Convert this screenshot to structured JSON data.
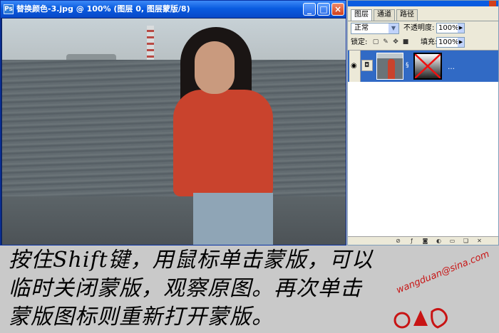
{
  "document_window": {
    "title": "替换颜色-3.jpg @ 100% (图层 0, 图层蒙版/8)",
    "app_icon": "Ps"
  },
  "layers_panel": {
    "tabs": [
      {
        "label": "图层",
        "active": true
      },
      {
        "label": "通道",
        "active": false
      },
      {
        "label": "路径",
        "active": false
      }
    ],
    "blend_mode": "正常",
    "opacity_label": "不透明度:",
    "opacity_value": "100%",
    "lock_label": "锁定:",
    "fill_label": "填充:",
    "fill_value": "100%",
    "layer": {
      "selected": true,
      "visible": true
    }
  },
  "caption": {
    "lines": [
      "按住Shift键，用鼠标单击蒙版，可以",
      "临时关闭蒙版，观察原图。再次单击",
      "蒙版图标则重新打开蒙版。"
    ]
  },
  "watermark": {
    "text": "wangduan@sina.com"
  },
  "colors": {
    "titlebar": "#0a5ce0",
    "selection": "#316ac5",
    "panel_bg": "#ece9d8",
    "page_bg": "#c9c9c9",
    "watermark": "#c81414"
  }
}
